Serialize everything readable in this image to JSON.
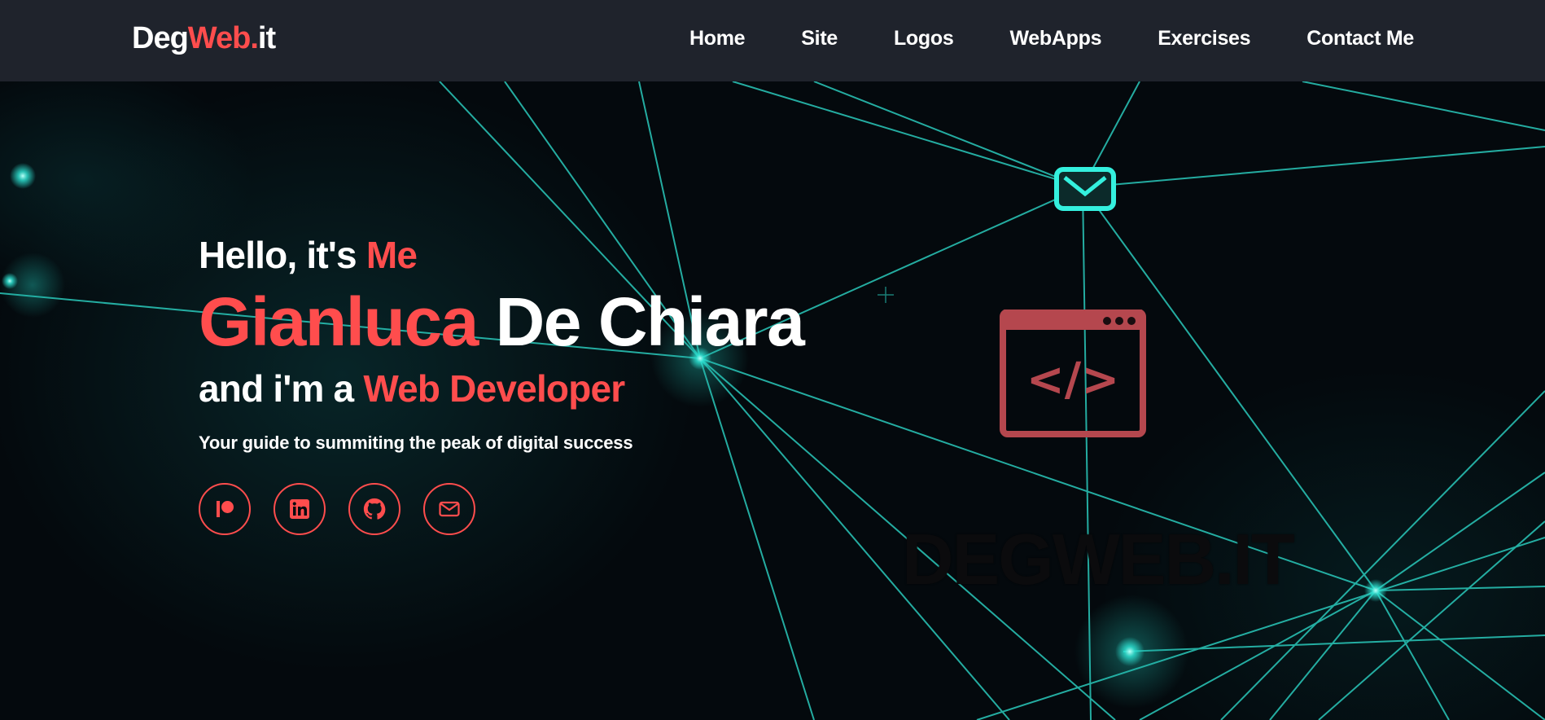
{
  "header": {
    "logo": {
      "part1": "Deg",
      "part2": "Web.",
      "part3": "it"
    },
    "nav": [
      {
        "label": "Home"
      },
      {
        "label": "Site"
      },
      {
        "label": "Logos"
      },
      {
        "label": "WebApps"
      },
      {
        "label": "Exercises"
      },
      {
        "label": "Contact Me"
      }
    ]
  },
  "hero": {
    "greeting_prefix": "Hello, it's ",
    "greeting_accent": "Me",
    "first_name": "Gianluca",
    "last_name": " De Chiara",
    "role_prefix": "and i'm a ",
    "role_accent": "Web Developer",
    "tagline": "Your guide to summiting the peak of digital success"
  },
  "social": [
    {
      "icon": "patreon-icon"
    },
    {
      "icon": "linkedin-icon"
    },
    {
      "icon": "github-icon"
    },
    {
      "icon": "mail-icon"
    }
  ],
  "emblem": {
    "code_symbol": "</>",
    "wordmark": "DEGWEB.IT"
  },
  "colors": {
    "accent": "#ff4d4d",
    "header_bg": "#1f232c",
    "network_cyan": "#2ee6d6",
    "emblem_red": "#b5474e"
  }
}
